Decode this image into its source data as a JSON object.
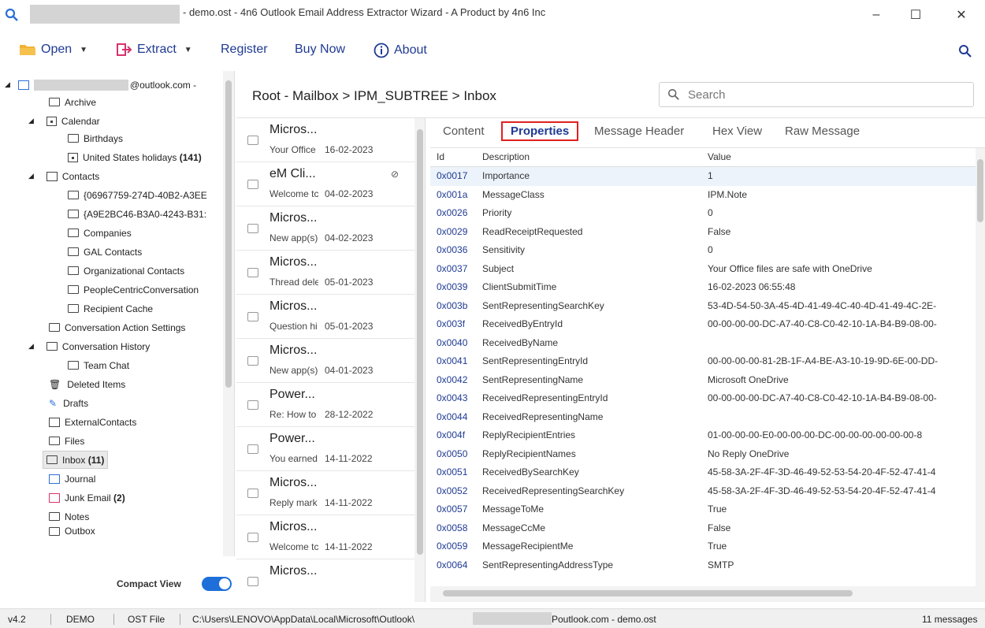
{
  "window": {
    "title": "- demo.ost - 4n6 Outlook Email Address Extractor Wizard - A Product by 4n6 Inc",
    "minimize": "–",
    "maximize": "☐",
    "close": "✕"
  },
  "toolbar": {
    "open": "Open",
    "extract": "Extract",
    "register": "Register",
    "buy_now": "Buy Now",
    "about": "About"
  },
  "tree": {
    "account": "@outlook.com -",
    "items": [
      {
        "label": "Archive"
      },
      {
        "label": "Calendar"
      },
      {
        "label": "Birthdays"
      },
      {
        "label": "United States holidays",
        "count": "(141)"
      },
      {
        "label": "Contacts"
      },
      {
        "label": "{06967759-274D-40B2-A3EE"
      },
      {
        "label": "{A9E2BC46-B3A0-4243-B31:"
      },
      {
        "label": "Companies"
      },
      {
        "label": "GAL Contacts"
      },
      {
        "label": "Organizational Contacts"
      },
      {
        "label": "PeopleCentricConversation"
      },
      {
        "label": "Recipient Cache"
      },
      {
        "label": "Conversation Action Settings"
      },
      {
        "label": "Conversation History"
      },
      {
        "label": "Team Chat"
      },
      {
        "label": "Deleted Items"
      },
      {
        "label": "Drafts"
      },
      {
        "label": "ExternalContacts"
      },
      {
        "label": "Files"
      },
      {
        "label": "Inbox",
        "count": "(11)"
      },
      {
        "label": "Journal"
      },
      {
        "label": "Junk Email",
        "count": "(2)"
      },
      {
        "label": "Notes"
      },
      {
        "label": "Outbox"
      }
    ],
    "compact_view": "Compact View"
  },
  "breadcrumb": "Root - Mailbox  >  IPM_SUBTREE  >  Inbox",
  "search": {
    "placeholder": "Search"
  },
  "messages": [
    {
      "from": "Micros...",
      "snippet": "Your Office",
      "date": "16-02-2023"
    },
    {
      "from": "eM Cli...",
      "snippet": "Welcome tc",
      "date": "04-02-2023",
      "attachment": "⊘"
    },
    {
      "from": "Micros...",
      "snippet": "New app(s)",
      "date": "04-02-2023"
    },
    {
      "from": "Micros...",
      "snippet": "Thread dele",
      "date": "05-01-2023"
    },
    {
      "from": "Micros...",
      "snippet": "Question hi",
      "date": "05-01-2023"
    },
    {
      "from": "Micros...",
      "snippet": "New app(s)",
      "date": "04-01-2023"
    },
    {
      "from": "Power...",
      "snippet": "Re: How to",
      "date": "28-12-2022"
    },
    {
      "from": "Power...",
      "snippet": "You earned",
      "date": "14-11-2022"
    },
    {
      "from": "Micros...",
      "snippet": "Reply mark",
      "date": "14-11-2022"
    },
    {
      "from": "Micros...",
      "snippet": "Welcome tc",
      "date": "14-11-2022"
    },
    {
      "from": "Micros...",
      "snippet": "",
      "date": ""
    }
  ],
  "tabs": [
    "Content",
    "Properties",
    "Message Header",
    "Hex View",
    "Raw Message"
  ],
  "properties": {
    "headers": {
      "id": "Id",
      "desc": "Description",
      "val": "Value"
    },
    "rows": [
      {
        "id": "0x0017",
        "desc": "Importance",
        "val": "1"
      },
      {
        "id": "0x001a",
        "desc": "MessageClass",
        "val": "IPM.Note"
      },
      {
        "id": "0x0026",
        "desc": "Priority",
        "val": "0"
      },
      {
        "id": "0x0029",
        "desc": "ReadReceiptRequested",
        "val": "False"
      },
      {
        "id": "0x0036",
        "desc": "Sensitivity",
        "val": "0"
      },
      {
        "id": "0x0037",
        "desc": "Subject",
        "val": "Your Office files are safe with OneDrive"
      },
      {
        "id": "0x0039",
        "desc": "ClientSubmitTime",
        "val": "16-02-2023 06:55:48"
      },
      {
        "id": "0x003b",
        "desc": "SentRepresentingSearchKey",
        "val": "53-4D-54-50-3A-45-4D-41-49-4C-40-4D-41-49-4C-2E-"
      },
      {
        "id": "0x003f",
        "desc": "ReceivedByEntryId",
        "val": "00-00-00-00-DC-A7-40-C8-C0-42-10-1A-B4-B9-08-00-"
      },
      {
        "id": "0x0040",
        "desc": "ReceivedByName",
        "val": ""
      },
      {
        "id": "0x0041",
        "desc": "SentRepresentingEntryId",
        "val": "00-00-00-00-81-2B-1F-A4-BE-A3-10-19-9D-6E-00-DD-"
      },
      {
        "id": "0x0042",
        "desc": "SentRepresentingName",
        "val": "Microsoft OneDrive"
      },
      {
        "id": "0x0043",
        "desc": "ReceivedRepresentingEntryId",
        "val": "00-00-00-00-DC-A7-40-C8-C0-42-10-1A-B4-B9-08-00-"
      },
      {
        "id": "0x0044",
        "desc": "ReceivedRepresentingName",
        "val": ""
      },
      {
        "id": "0x004f",
        "desc": "ReplyRecipientEntries",
        "val": "01-00-00-00-E0-00-00-00-DC-00-00-00-00-00-00-8"
      },
      {
        "id": "0x0050",
        "desc": "ReplyRecipientNames",
        "val": "No Reply OneDrive"
      },
      {
        "id": "0x0051",
        "desc": "ReceivedBySearchKey",
        "val": "45-58-3A-2F-4F-3D-46-49-52-53-54-20-4F-52-47-41-4"
      },
      {
        "id": "0x0052",
        "desc": "ReceivedRepresentingSearchKey",
        "val": "45-58-3A-2F-4F-3D-46-49-52-53-54-20-4F-52-47-41-4"
      },
      {
        "id": "0x0057",
        "desc": "MessageToMe",
        "val": "True"
      },
      {
        "id": "0x0058",
        "desc": "MessageCcMe",
        "val": "False"
      },
      {
        "id": "0x0059",
        "desc": "MessageRecipientMe",
        "val": "True"
      },
      {
        "id": "0x0064",
        "desc": "SentRepresentingAddressType",
        "val": "SMTP"
      }
    ]
  },
  "status": {
    "version": "v4.2",
    "mode": "DEMO",
    "file_type": "OST File",
    "path_start": "C:\\Users\\LENOVO\\AppData\\Local\\Microsoft\\Outlook\\",
    "path_end": "Poutlook.com - demo.ost",
    "count": "11 messages"
  },
  "colors": {
    "accent": "#1f3a93",
    "highlight": "#e02020",
    "toggle": "#1e6fd9"
  }
}
